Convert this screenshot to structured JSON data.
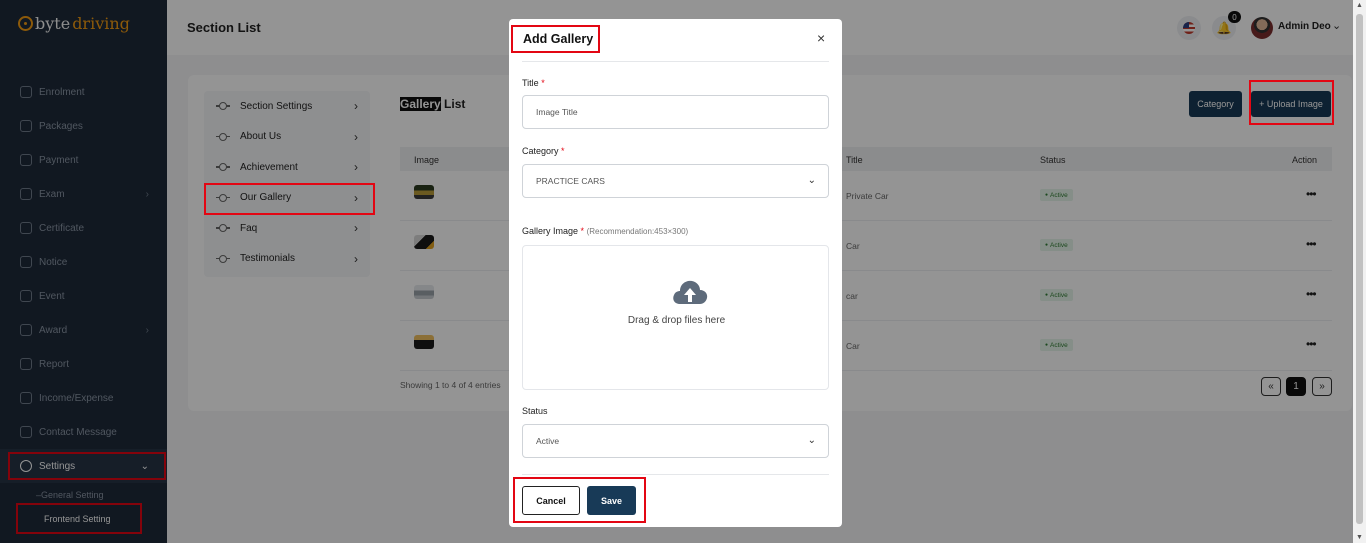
{
  "brand": {
    "part1": "byte",
    "part2": "driving"
  },
  "sidebar": {
    "items": [
      {
        "label": "Enrolment",
        "icon": "enrolment-icon"
      },
      {
        "label": "Packages",
        "icon": "packages-icon"
      },
      {
        "label": "Payment",
        "icon": "payment-icon"
      },
      {
        "label": "Exam",
        "icon": "exam-icon"
      },
      {
        "label": "Certificate",
        "icon": "certificate-icon"
      },
      {
        "label": "Notice",
        "icon": "notice-icon"
      },
      {
        "label": "Event",
        "icon": "event-icon"
      },
      {
        "label": "Award",
        "icon": "award-icon"
      },
      {
        "label": "Report",
        "icon": "report-icon"
      },
      {
        "label": "Income/Expense",
        "icon": "income-expense-icon"
      },
      {
        "label": "Contact Message",
        "icon": "contact-message-icon"
      },
      {
        "label": "Settings",
        "icon": "gear-icon"
      }
    ],
    "sub_items": [
      {
        "label": "General Setting"
      },
      {
        "label": "Frontend Setting"
      }
    ]
  },
  "header": {
    "title": "Section List",
    "notification_count": "0",
    "user_name": "Admin Deo"
  },
  "section_menu": {
    "items": [
      {
        "label": "Section Settings"
      },
      {
        "label": "About Us"
      },
      {
        "label": "Achievement"
      },
      {
        "label": "Our Gallery"
      },
      {
        "label": "Faq"
      },
      {
        "label": "Testimonials"
      }
    ]
  },
  "gallery": {
    "title_highlight": "Gallery",
    "title_rest": " List",
    "category_button": "Category",
    "upload_button": "+ Upload Image",
    "columns": {
      "image": "Image",
      "title": "Title",
      "status": "Status",
      "action": "Action"
    },
    "rows": [
      {
        "title": "Private Car",
        "status": "Active"
      },
      {
        "title": "Car",
        "status": "Active"
      },
      {
        "title": "car",
        "status": "Active"
      },
      {
        "title": "Car",
        "status": "Active"
      }
    ],
    "showing": "Showing 1 to 4 of 4 entries",
    "pagination": {
      "prev": "«",
      "page": "1",
      "next": "»"
    }
  },
  "modal": {
    "title": "Add Gallery",
    "close": "×",
    "title_label": "Title",
    "title_placeholder": "Image Title",
    "category_label": "Category",
    "category_value": "PRACTICE CARS",
    "image_label": "Gallery Image",
    "image_hint": "(Recommendation:453×300)",
    "drop_text": "Drag & drop files here",
    "status_label": "Status",
    "status_value": "Active",
    "required_mark": "*",
    "cancel": "Cancel",
    "save": "Save"
  },
  "colors": {
    "sidebar_bg": "#1e2a3a",
    "brand": "#f39c12",
    "primary": "#183a57",
    "highlight_box": "#e30613",
    "active_badge": "#2e7d32"
  }
}
